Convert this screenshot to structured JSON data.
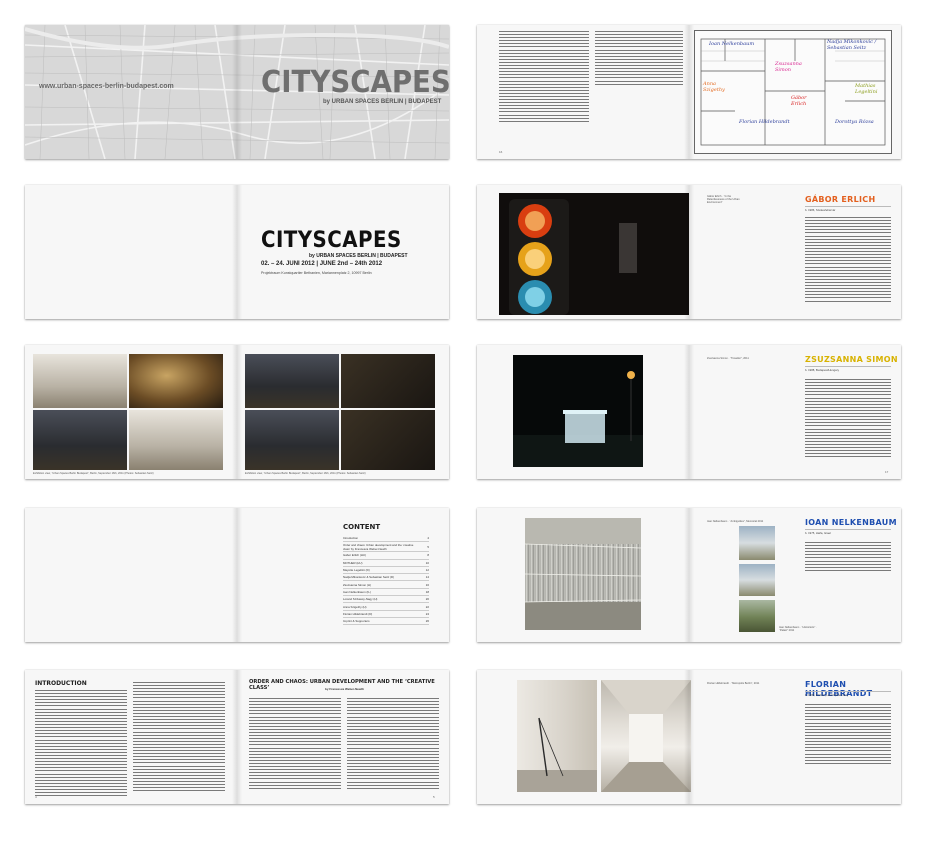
{
  "cover": {
    "title": "CITYSCAPES",
    "subtitle": "by URBAN SPACES BERLIN | BUDAPEST",
    "url": "www.urban-spaces-berlin-budapest.com"
  },
  "title_page": {
    "title": "CITYSCAPES",
    "subtitle": "by URBAN SPACES BERLIN | BUDAPEST",
    "dates": "02. – 24. JUNI 2012 | JUNE 2nd – 24th 2012",
    "venue": "Projektraum Kunstquartier Bethanien, Mariannenplatz 2, 10997 Berlin"
  },
  "gallery": {
    "caption_left": "Exhibition view, “Urban Spaces Berlin Budapest”, Berlin, September 16th, 2011 (Photos: Sebastian Seitz)",
    "caption_right": "Exhibition view, “Urban Spaces Berlin Budapest”, Berlin, September 16th, 2011 (Photos: Sebastian Seitz)"
  },
  "contents": {
    "title": "CONTENT",
    "items": [
      {
        "label": "Introduction",
        "page": "4"
      },
      {
        "label": "Order and chaos: Urban development and the ‘creative class’ by Francesca Weber-Newth",
        "page": "5"
      },
      {
        "label": "Gábor Erlich (HU)",
        "page": "8"
      },
      {
        "label": "MOTHER (HU)",
        "page": "10"
      },
      {
        "label": "Mayotte Legeltini (D)",
        "page": "12"
      },
      {
        "label": "Nadja Mikonkovic & Sebastian Seitz (D)",
        "page": "14"
      },
      {
        "label": "Zsuzsanna Simon (H)",
        "page": "16"
      },
      {
        "label": "Ioan Nelkenbaum (IL)",
        "page": "18"
      },
      {
        "label": "Lorand Szilvassy-Nagy (H)",
        "page": "20"
      },
      {
        "label": "Anna Szigethy (H)",
        "page": "22"
      },
      {
        "label": "Florian Hildebrandt (D)",
        "page": "24"
      },
      {
        "label": "Imprint & Supporters",
        "page": "26"
      }
    ]
  },
  "intro": {
    "heading": "INTRODUCTION",
    "order_heading": "ORDER AND CHAOS: URBAN DEVELOPMENT AND THE ‘CREATIVE CLASS’",
    "order_byline": "by Francesca Weber-Newth"
  },
  "floorplan": {
    "labels": [
      "Ioan Nelkenbaum",
      "Nadja Mikonkovic / Sebastian Seitz",
      "Zsuzsanna Simon",
      "Anna Szigethy",
      "Gábor Erlich",
      "Florian Hildebrandt",
      "Dorottya Rózsa",
      "Mathias Legeltini"
    ]
  },
  "artists": [
    {
      "name": "GÁBOR ERLICH",
      "meta": "b. 1986, Székesfehérvár",
      "caption": "Gábor Erlich · “In the Relentlessness of the Urban Environment”"
    },
    {
      "name": "ZSUZSANNA SIMON",
      "meta": "b. 1988, Budapest/Hungary",
      "caption": "Zsuzsanna Simon · “Traveller”, 2011"
    },
    {
      "name": "IOAN NELKENBAUM",
      "meta": "b. 1975, Haifa, Israel",
      "caption": "Ioan Nelkenbaum · “Ambiguities”, Memorial 2011",
      "caption2": "Ioan Nelkenbaum · “Historiscis” · “Palast” 2011"
    },
    {
      "name": "FLORIAN HILDEBRANDT",
      "meta": "b. 1984, Fritzlar (Lausitz)/Germany",
      "caption": "Florian Hildebrandt · “Metropolis Berlin”, 2011"
    }
  ],
  "pages": {
    "left_num": "4",
    "right_num": "5",
    "p6": "16",
    "p7": "17"
  }
}
